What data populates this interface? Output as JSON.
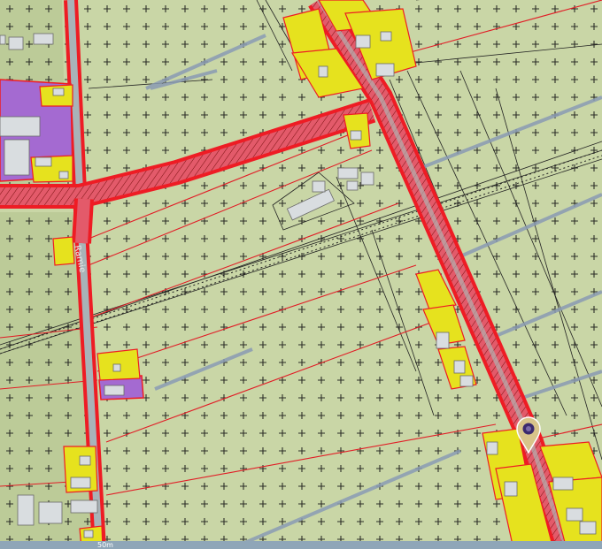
{
  "map": {
    "road_label": "Ramie",
    "scale_text": "50m",
    "colors": {
      "agricultural": "#c9d6a6",
      "agricultural_dark": "#b9c896",
      "road_red": "#ee1c24",
      "road_fill": "#e35a6a",
      "residential": "#e6e21e",
      "service": "#9b59b6",
      "building": "#d9dde0",
      "boundary": "#222222",
      "marker_body": "#d8c48a",
      "marker_dot": "#3b2a6e"
    },
    "marker_icon": "location-pin-icon"
  }
}
